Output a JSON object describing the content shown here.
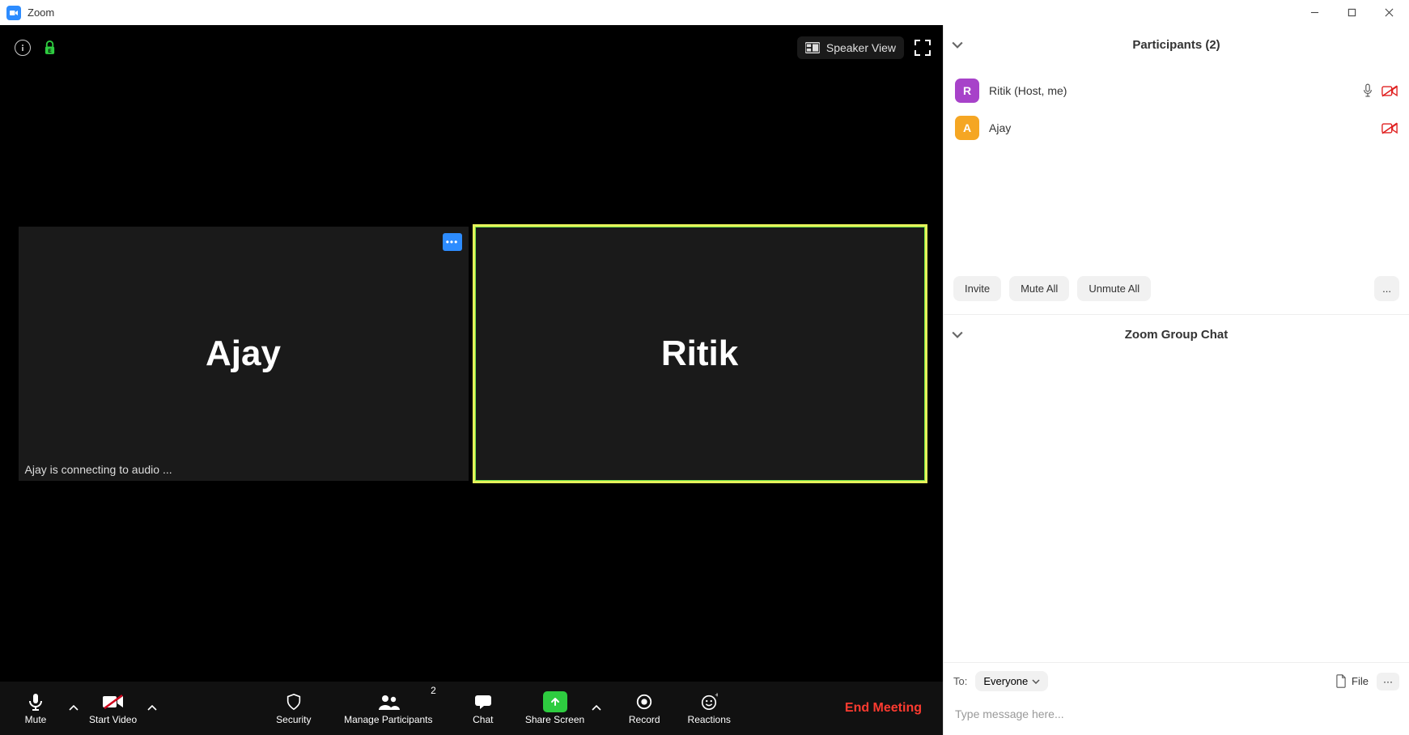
{
  "titlebar": {
    "title": "Zoom"
  },
  "video": {
    "speaker_view_label": "Speaker View",
    "tiles": [
      {
        "name": "Ajay",
        "status": "Ajay is connecting to audio ..."
      },
      {
        "name": "Ritik"
      }
    ]
  },
  "toolbar": {
    "mute": "Mute",
    "start_video": "Start Video",
    "security": "Security",
    "manage_participants": "Manage Participants",
    "participants_count": "2",
    "chat": "Chat",
    "share_screen": "Share Screen",
    "record": "Record",
    "reactions": "Reactions",
    "end_meeting": "End Meeting"
  },
  "participants": {
    "header": "Participants (2)",
    "list": [
      {
        "initial": "R",
        "name": "Ritik (Host, me)",
        "avatar_color": "purple",
        "has_mic": true,
        "video_off": true
      },
      {
        "initial": "A",
        "name": "Ajay",
        "avatar_color": "orange",
        "has_mic": false,
        "video_off": true
      }
    ],
    "actions": {
      "invite": "Invite",
      "mute_all": "Mute All",
      "unmute_all": "Unmute All",
      "more": "..."
    }
  },
  "chat": {
    "header": "Zoom Group Chat",
    "to_label": "To:",
    "to_value": "Everyone",
    "file_label": "File",
    "more": "···",
    "placeholder": "Type message here..."
  }
}
